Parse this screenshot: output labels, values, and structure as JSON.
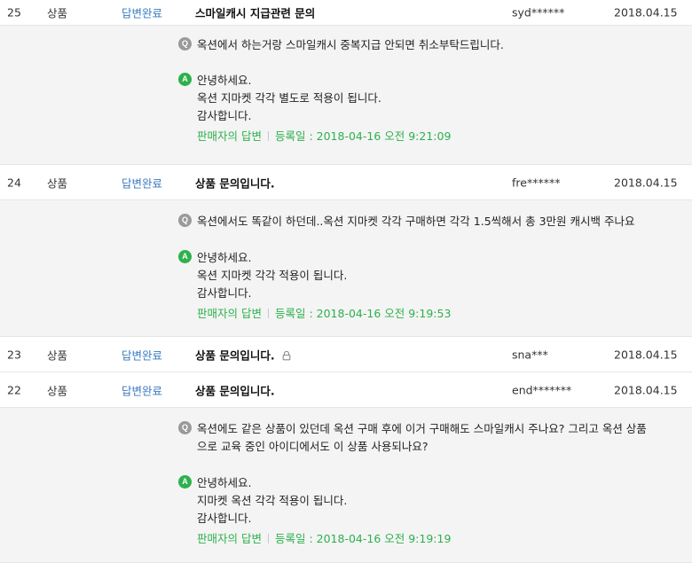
{
  "rows": [
    {
      "no": "25",
      "category": "상품",
      "status": "답변완료",
      "title": "스마일캐시 지급관련 문의",
      "user": "syd******",
      "date": "2018.04.15"
    },
    {
      "no": "24",
      "category": "상품",
      "status": "답변완료",
      "title": "상품 문의입니다.",
      "user": "fre******",
      "date": "2018.04.15"
    },
    {
      "no": "23",
      "category": "상품",
      "status": "답변완료",
      "title": "상품 문의입니다.",
      "user": "sna***",
      "date": "2018.04.15"
    },
    {
      "no": "22",
      "category": "상품",
      "status": "답변완료",
      "title": "상품 문의입니다.",
      "user": "end*******",
      "date": "2018.04.15"
    }
  ],
  "qa": [
    {
      "question_lines": [
        "옥션에서 하는거랑 스마일캐시 중복지급 안되면 취소부탁드립니다."
      ],
      "answer_lines": [
        "안녕하세요.",
        "옥션 지마켓 각각 별도로 적용이 됩니다.",
        "감사합니다."
      ],
      "seller_label": "판매자의 답변",
      "registered": "등록일 : 2018-04-16 오전 9:21:09"
    },
    {
      "question_lines": [
        "옥션에서도 똑같이 하던데..옥션 지마켓 각각 구매하면 각각 1.5씩해서 총 3만원 캐시백 주나요"
      ],
      "answer_lines": [
        "안녕하세요.",
        "옥션 지마켓 각각 적용이 됩니다.",
        "감사합니다."
      ],
      "seller_label": "판매자의 답변",
      "registered": "등록일 : 2018-04-16 오전 9:19:53"
    },
    {
      "question_lines": [
        "옥션에도 같은 상품이 있던데 옥션 구매 후에 이거 구매해도 스마일캐시 주나요? 그리고 옥션 상품",
        "으로 교육 중인 아이디에서도 이 상품 사용되나요?"
      ],
      "answer_lines": [
        "안녕하세요.",
        "지마켓 옥션 각각 적용이 됩니다.",
        "감사합니다."
      ],
      "seller_label": "판매자의 답변",
      "registered": "등록일 : 2018-04-16 오전 9:19:19"
    }
  ],
  "labels": {
    "q_badge": "Q",
    "a_badge": "A"
  },
  "icons": {
    "lock": "lock-icon"
  },
  "colors": {
    "status": "#3a7bbf",
    "answer_meta": "#2db14c",
    "q_badge": "#9a9a9a",
    "a_badge": "#2db14c",
    "detail_bg": "#f4f4f4"
  }
}
